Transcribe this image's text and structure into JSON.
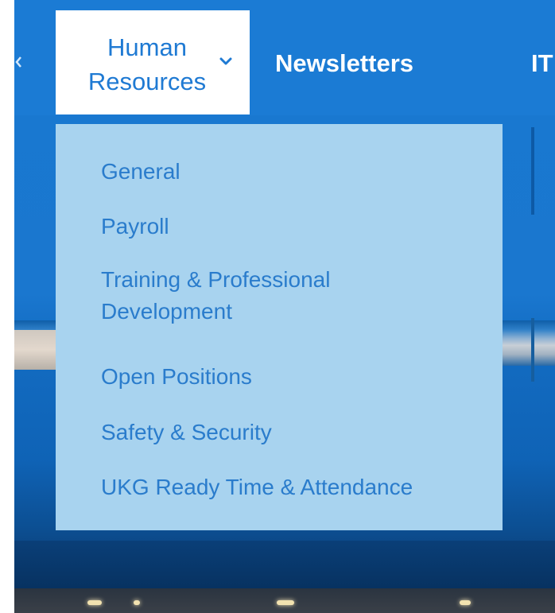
{
  "nav": {
    "items": [
      {
        "label_lines": [
          "Human",
          "Resources"
        ],
        "state": "expanded"
      },
      {
        "label": "Newsletters"
      },
      {
        "label": "IT"
      }
    ]
  },
  "dropdown": {
    "items": [
      {
        "lines": [
          "General"
        ]
      },
      {
        "lines": [
          "Payroll"
        ]
      },
      {
        "lines": [
          "Training & Professional",
          "Development"
        ]
      },
      {
        "lines": [
          "Open Positions"
        ]
      },
      {
        "lines": [
          "Safety & Security"
        ]
      },
      {
        "lines": [
          "UKG Ready Time & Attendance"
        ]
      }
    ]
  },
  "colors": {
    "nav_background": "#1b7bd4",
    "active_tab_background": "#ffffff",
    "active_tab_text": "#1f7ad3",
    "dropdown_background": "#a8d3ef",
    "dropdown_text": "#2a7ccc",
    "nav_text": "#ffffff"
  },
  "icons": {
    "expand": "chevron-down-icon",
    "previous": "chevron-left-icon"
  }
}
